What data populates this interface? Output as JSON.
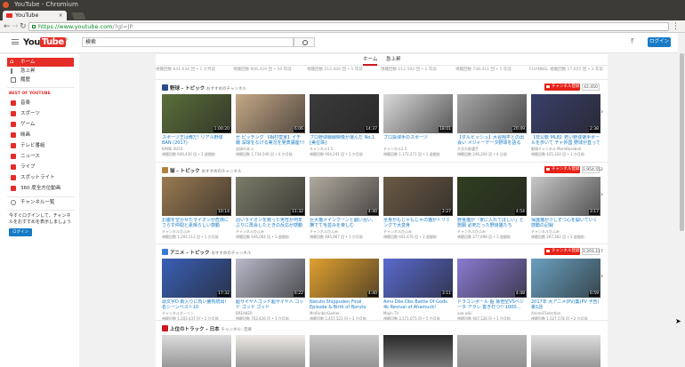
{
  "window": {
    "title": "YouTube - Chromium"
  },
  "browser": {
    "tab_title": "YouTube",
    "address_secure": "https://www.youtube.com",
    "address_rest": "/?gl=JP"
  },
  "masthead": {
    "search_value": "検索",
    "login_label": "ログイン"
  },
  "page_tabs": [
    {
      "label": "ホーム"
    },
    {
      "label": "急上昇"
    }
  ],
  "sidebar": {
    "items": [
      {
        "label": "ホーム"
      },
      {
        "label": "急上昇"
      },
      {
        "label": "履歴"
      }
    ],
    "best_heading": "BEST OF YOUTUBE",
    "best": [
      {
        "label": "音楽"
      },
      {
        "label": "スポーツ"
      },
      {
        "label": "ゲーム"
      },
      {
        "label": "映画"
      },
      {
        "label": "テレビ番組"
      },
      {
        "label": "ニュース"
      },
      {
        "label": "ライブ"
      },
      {
        "label": "スポットライト"
      },
      {
        "label": "360 度全方位動画"
      }
    ],
    "channels_label": "チャンネル一覧",
    "signin_note": "今すぐログインして、チャンネルをおすすめを表示しましょう",
    "signin_button": "ログイン"
  },
  "top_meta": [
    "視聴回数 641,634 回 • 1 か月前",
    "視聴回数 906,419 回 • 10 年前",
    "視聴回数 212,000 回 • 1 年前",
    "視聴回数 212,593 回 • 1 年前",
    "視聴回数 738,411 回 • 1 年前",
    "CHANNEL 視聴回数 17,655 回 • 3 年前"
  ],
  "shelves": [
    {
      "title": "野球 - トピック",
      "sub": "おすすめのチャンネル",
      "subscribe": "チャンネル登録",
      "count": "42,450",
      "videos": [
        {
          "title": "スポーツ王は俺だ! リアル野球BAN (2017)",
          "channel": "KAWE SUS3",
          "stats": "視聴回数 646,430 回 • 1 週間前",
          "dur": "1:00:20"
        },
        {
          "title": "ゼ ピッチング 【相村皇家】イチ戦 深球をなげる実況を発表講座!!!",
          "channel": "送球の本コ",
          "stats": "視聴回数 1,734,546 回 • 4 か月前",
          "dur": "6:06"
        },
        {
          "title": "プロ野球戦線映像が選んだ No.1 [美位珠]",
          "channel": "チャンネル1.5",
          "stats": "視聴回数 664,241 回 • 1 か月前",
          "dur": "14:37"
        },
        {
          "title": "プロ投球手のスポーツ",
          "channel": "チャンネル1.5",
          "stats": "視聴回数 1,172,271 回 • 1 週間前",
          "dur": "18:01"
        },
        {
          "title": "【ダルビッシュ】大谷翔平との出会い メジャーデータ野球を語る",
          "channel": "大谷大郎選手",
          "stats": "視聴回数 246,264 回 • 4 日前",
          "dur": "20:49"
        },
        {
          "title": "【非公転 MLB】若い野球選手ボールを歩いて チャ外国 野球が直っている!",
          "channel": "野球チャンネル MoreBaseball",
          "stats": "視聴回数 425,324 回 • 1 か月前",
          "dur": "2:38"
        }
      ]
    },
    {
      "title": "猫 - トピック",
      "sub": "おすすめのチャンネル",
      "subscribe": "チャンネル登録",
      "count": "1,954,552",
      "videos": [
        {
          "title": "お腹を空かせたライオンが危険にさらす仲間と素晴らしい感動",
          "channel": "チャンネルひふみ",
          "stats": "視聴回数 1,293,112 回 • 1 か月前",
          "dur": "10:14"
        },
        {
          "title": "凶いライオンを救った男性が何年ぶりに再会したときの反応が感動的",
          "channel": "チャンネルひふみ",
          "stats": "視聴回数 936,064 回 • 3 週間前",
          "dur": "11:32"
        },
        {
          "title": "巨大猫メインクーンと戯い合い、撫でて毛並みを楽しむ",
          "channel": "チャンネルひふみ",
          "stats": "視聴回数 485,967 回 • 1 か月前",
          "dur": "4:40"
        },
        {
          "title": "全身がもじゃもじゃの猫がトリミングで大変身",
          "channel": "チャンネルひふみ",
          "stats": "視聴回数 601,476 回 • 3 週間前",
          "dur": "2:27"
        },
        {
          "title": "野良猫が「家に入れてほしい」と懇願 必死だった野良猫たち",
          "channel": "チャンネルひふみ",
          "stats": "視聴回数 277,898 回 • 3 週間前",
          "dur": "4:54"
        },
        {
          "title": "保護猫が少しずつ心を開いていく感動の記録",
          "channel": "チャンネルひふみ",
          "stats": "視聴回数 267,362 回 • 3 週間前",
          "dur": "3:17"
        }
      ]
    },
    {
      "title": "アニメ - トピック",
      "sub": "おすすめのチャンネル",
      "subscribe": "チャンネル登録",
      "count": "1,201,117",
      "videos": [
        {
          "title": "頭文字D 新入りに負い勝負続出！ 名シーンベスト10",
          "channel": "チャンネルオーリン",
          "stats": "視聴回数 1,203,437 回 • 2 か月前",
          "dur": "17:32"
        },
        {
          "title": "超サイヤ人ゴッド超サイヤ人 ゴッド ゴッド ゴッド",
          "channel": "BREAKER",
          "stats": "視聴回数 702,426 回 • 3 か月前",
          "dur": "6:22"
        },
        {
          "title": "Naruto Shippuden Final Episode & Birth of Boruto (English Sub)",
          "channel": "MrsRinbo!Gamer",
          "stats": "視聴回数 5,457,521 回 • 3 か月前",
          "dur": "4:40"
        },
        {
          "title": "Amv Dbs Dbs Battle Of Gods 4k Revival of Ahamuck!",
          "channel": "Majin TV",
          "stats": "視聴回数 3,571,075 回 • 5 か月前",
          "dur": "3:11"
        },
        {
          "title": "ドラゴンボール 超 孫悟空VSベジータ アラレ 抜き打つ!! 1000...",
          "channel": "aaa wiki",
          "stats": "視聴回数 907,126 回 • 1 か月前",
          "dur": "4:48"
        },
        {
          "title": "2017年 大アニメ(PV)集(PV 予告) 第1話",
          "channel": "AnimeFSelection",
          "stats": "視聴回数 1,527,578 回 • 2 か月前",
          "dur": "6:59"
        }
      ]
    },
    {
      "title": "上位のトラック - 日本",
      "sub": "チャンネル: 音楽"
    }
  ]
}
